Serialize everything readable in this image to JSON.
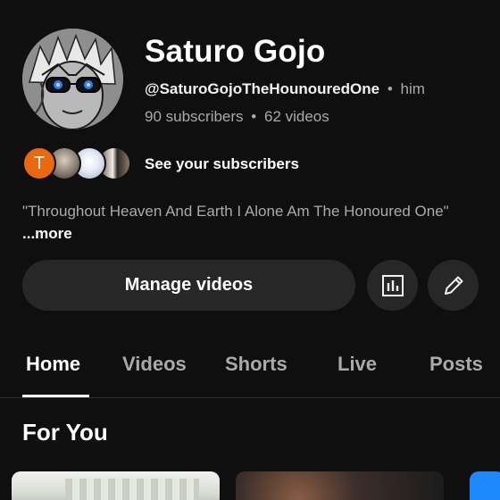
{
  "channel": {
    "name": "Saturo Gojo",
    "handle": "@SaturoGojoTheHounouredOne",
    "separator": "•",
    "pronoun": "him",
    "subscribers": "90 subscribers",
    "videos": "62 videos"
  },
  "subscribers_preview": {
    "first_initial": "T",
    "label": "See your subscribers"
  },
  "bio": {
    "text": "\"Throughout Heaven And Earth I Alone Am The Honoured One\"",
    "more_label": "...more"
  },
  "actions": {
    "manage_label": "Manage videos",
    "analytics_icon": "analytics-icon",
    "edit_icon": "pencil-icon"
  },
  "tabs": [
    "Home",
    "Videos",
    "Shorts",
    "Live",
    "Posts"
  ],
  "section": {
    "title": "For You"
  },
  "colors": {
    "background": "#0f0f0f",
    "button_bg": "#272727",
    "secondary_text": "#aaaaaa",
    "avatar_orange": "#e8690f",
    "eye_blue": "#2f7bff"
  }
}
